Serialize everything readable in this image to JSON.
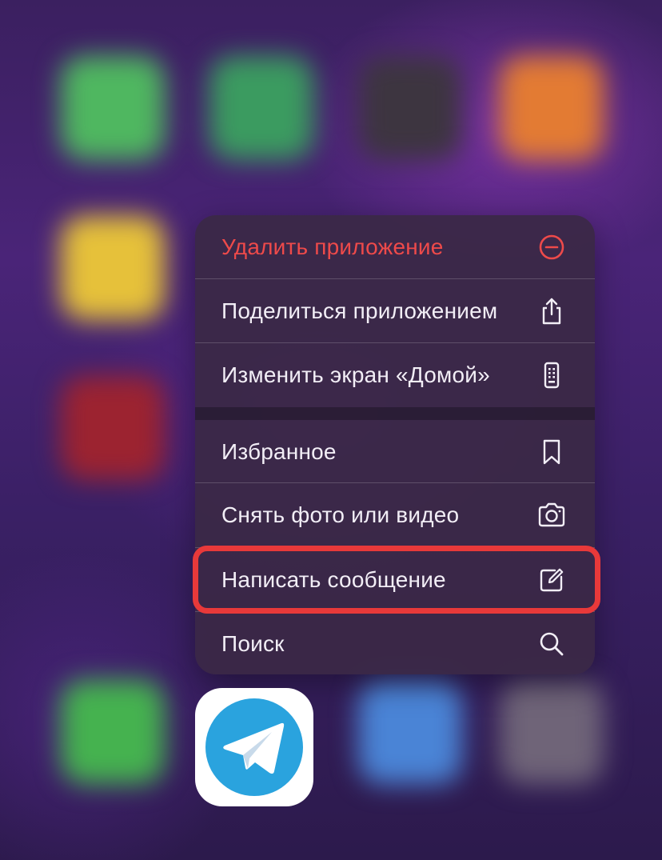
{
  "context_menu": {
    "items": [
      {
        "label": "Удалить приложение",
        "icon": "minus-circle-icon",
        "destructive": true
      },
      {
        "label": "Поделиться приложением",
        "icon": "share-icon"
      },
      {
        "label": "Изменить экран «Домой»",
        "icon": "phone-apps-icon"
      },
      {
        "label": "Избранное",
        "icon": "bookmark-icon"
      },
      {
        "label": "Снять фото или видео",
        "icon": "camera-icon"
      },
      {
        "label": "Написать сообщение",
        "icon": "compose-icon",
        "highlighted": true
      },
      {
        "label": "Поиск",
        "icon": "search-icon"
      }
    ]
  },
  "app": {
    "name": "Telegram",
    "icon": "telegram-icon"
  },
  "colors": {
    "destructive": "#ee4a4a",
    "highlight_border": "#e8393a",
    "telegram_blue": "#2aa3de",
    "menu_text": "#f2eef6"
  }
}
